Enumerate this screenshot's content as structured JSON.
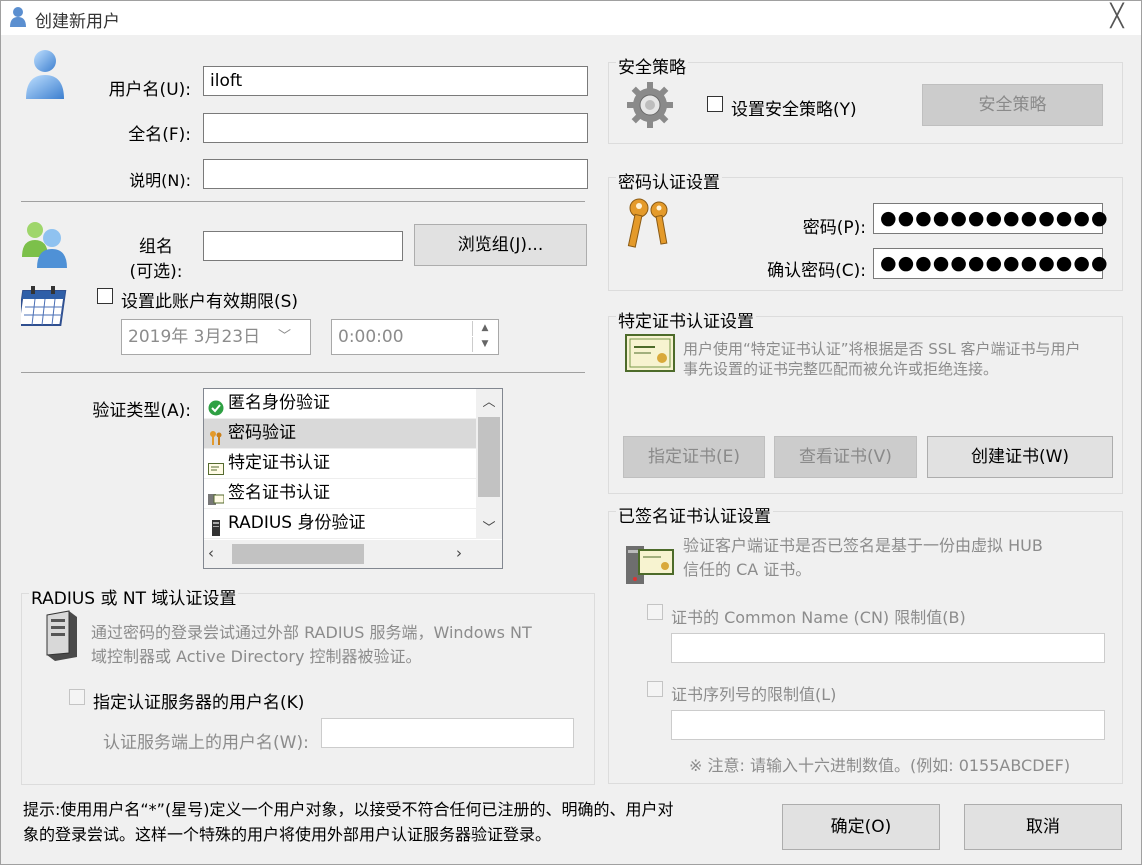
{
  "window": {
    "title": "创建新用户",
    "close_label": "╳"
  },
  "user": {
    "username_label": "用户名(U):",
    "username_value": "iloft",
    "fullname_label": "全名(F):",
    "fullname_value": "",
    "desc_label": "说明(N):",
    "desc_value": ""
  },
  "group": {
    "label_line1": "组名",
    "label_line2": "(可选):",
    "value": "",
    "browse_button": "浏览组(J)..."
  },
  "expiry": {
    "checkbox_label": "设置此账户有效期限(S)",
    "date_value": "2019年  3月23日",
    "time_value": "0:00:00"
  },
  "auth_type": {
    "label": "验证类型(A):",
    "items": [
      {
        "label": "匿名身份验证",
        "icon": "check-circle-icon"
      },
      {
        "label": "密码验证",
        "icon": "keys-icon"
      },
      {
        "label": "特定证书认证",
        "icon": "certificate-icon"
      },
      {
        "label": "签名证书认证",
        "icon": "signed-cert-icon"
      },
      {
        "label": "RADIUS 身份验证",
        "icon": "server-icon"
      }
    ]
  },
  "radius": {
    "group_title": "RADIUS 或 NT 域认证设置",
    "desc_line1": "通过密码的登录尝试通过外部 RADIUS 服务端，Windows NT",
    "desc_line2": "域控制器或 Active Directory 控制器被验证。",
    "checkbox_label": "指定认证服务器的用户名(K)",
    "username_label": "认证服务端上的用户名(W):",
    "username_value": ""
  },
  "security_policy": {
    "group_title": "安全策略",
    "checkbox_label": "设置安全策略(Y)",
    "button": "安全策略"
  },
  "password": {
    "group_title": "密码认证设置",
    "password_label": "密码(P):",
    "password_value": "●●●●●●●●●●●●●",
    "confirm_label": "确认密码(C):",
    "confirm_value": "●●●●●●●●●●●●●"
  },
  "cert": {
    "group_title": "特定证书认证设置",
    "desc_line1": "用户使用“特定证书认证”将根据是否 SSL 客户端证书与用户",
    "desc_line2": "事先设置的证书完整匹配而被允许或拒绝连接。",
    "specify_button": "指定证书(E)",
    "view_button": "查看证书(V)",
    "create_button": "创建证书(W)"
  },
  "signed_cert": {
    "group_title": "已签名证书认证设置",
    "desc_line1": "验证客户端证书是否已签名是基于一份由虚拟 HUB",
    "desc_line2": "信任的 CA 证书。",
    "cn_label": "证书的 Common Name (CN) 限制值(B)",
    "cn_value": "",
    "serial_label": "证书序列号的限制值(L)",
    "serial_value": "",
    "note": "※ 注意: 请输入十六进制数值。(例如: 0155ABCDEF)"
  },
  "hint": {
    "line1": "提示:使用用户名“*”(星号)定义一个用户对象，以接受不符合任何已注册的、明确的、用户对",
    "line2": "象的登录尝试。这样一个特殊的用户将使用外部用户认证服务器验证登录。"
  },
  "footer": {
    "ok_button": "确定(O)",
    "cancel_button": "取消"
  }
}
